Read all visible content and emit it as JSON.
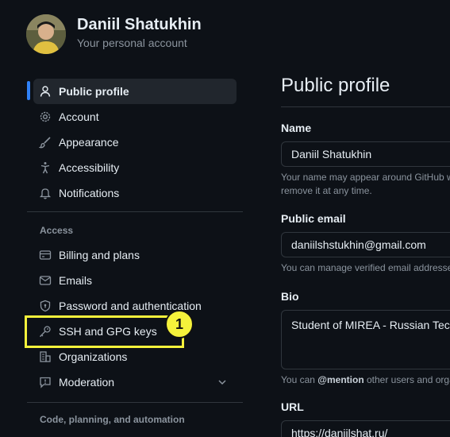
{
  "user": {
    "name": "Daniil Shatukhin",
    "subtitle": "Your personal account"
  },
  "sidebar": {
    "items": [
      {
        "label": "Public profile",
        "icon": "person-icon",
        "active": true
      },
      {
        "label": "Account",
        "icon": "gear-icon"
      },
      {
        "label": "Appearance",
        "icon": "paintbrush-icon"
      },
      {
        "label": "Accessibility",
        "icon": "accessibility-icon"
      },
      {
        "label": "Notifications",
        "icon": "bell-icon"
      }
    ],
    "access_label": "Access",
    "access_items": [
      {
        "label": "Billing and plans",
        "icon": "credit-card-icon"
      },
      {
        "label": "Emails",
        "icon": "mail-icon"
      },
      {
        "label": "Password and authentication",
        "icon": "shield-lock-icon"
      },
      {
        "label": "SSH and GPG keys",
        "icon": "key-icon"
      },
      {
        "label": "Organizations",
        "icon": "organization-icon"
      },
      {
        "label": "Moderation",
        "icon": "report-icon"
      }
    ],
    "code_label": "Code, planning, and automation"
  },
  "annotation": {
    "badge": "1",
    "color": "#f5f23b"
  },
  "main": {
    "title": "Public profile",
    "name_label": "Name",
    "name_value": "Daniil Shatukhin",
    "name_help_1": "Your name may appear around GitHub w",
    "name_help_2": "remove it at any time.",
    "email_label": "Public email",
    "email_value": "daniilshstukhin@gmail.com",
    "email_help": "You can manage verified email addresse",
    "bio_label": "Bio",
    "bio_value": "Student of MIREA - Russian Tec",
    "bio_help_prefix": "You can",
    "bio_help_mention": "@mention",
    "bio_help_suffix": "other users and orga",
    "url_label": "URL",
    "url_value": "https://daniilshat.ru/"
  },
  "colors": {
    "background": "#0d1117",
    "accent": "#2f81f7",
    "text": "#e6edf3",
    "muted": "#8b949e"
  }
}
